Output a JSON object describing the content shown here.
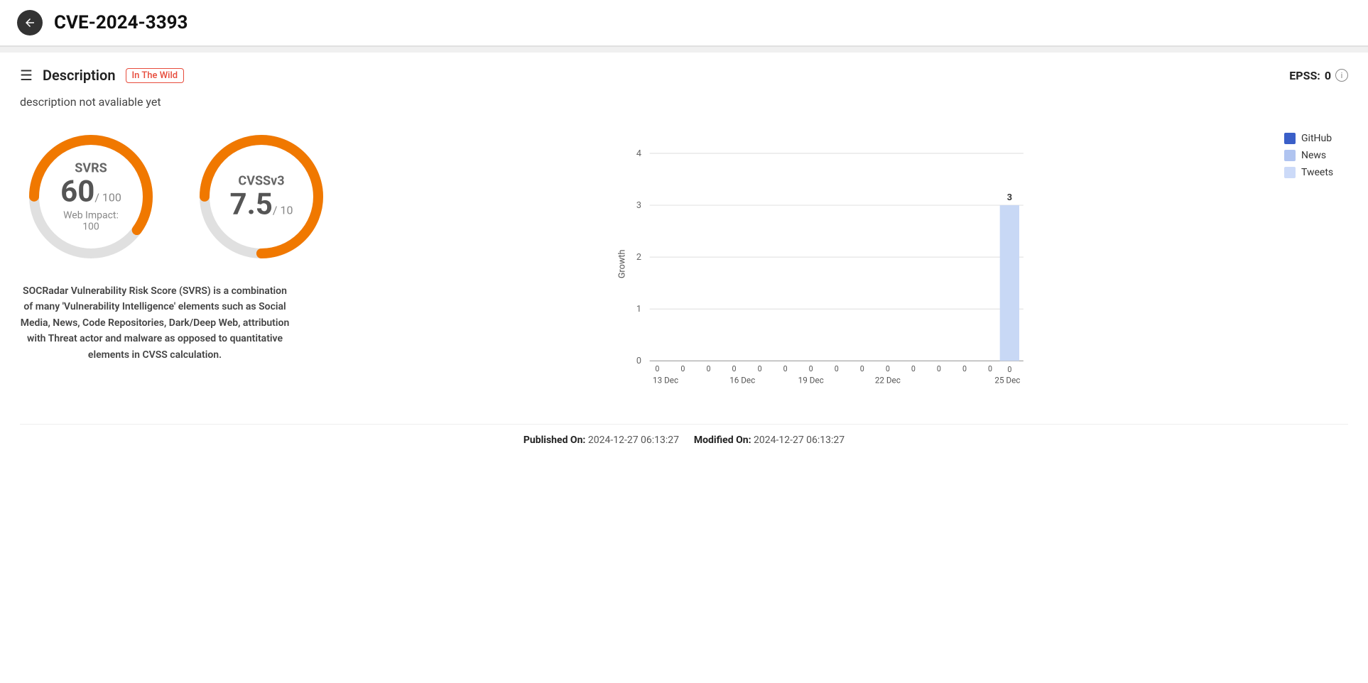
{
  "header": {
    "title": "CVE-2024-3393",
    "back_label": "back"
  },
  "description_section": {
    "title": "Description",
    "badge": "In The Wild",
    "desc_text": "description not avaliable yet",
    "epss_label": "EPSS:",
    "epss_value": "0"
  },
  "svrs": {
    "name": "SVRS",
    "value": "60",
    "denom": "/ 100",
    "sub": "Web Impact: 100",
    "gauge_percent": 60,
    "desc": "SOCRadar Vulnerability Risk Score (SVRS) is a combination of many 'Vulnerability Intelligence' elements such as Social Media, News, Code Repositories, Dark/Deep Web, attribution with Threat actor and malware as opposed to quantitative elements in CVSS calculation."
  },
  "cvss": {
    "name": "CVSSv3",
    "value": "7.5",
    "denom": "/ 10",
    "gauge_percent": 75
  },
  "chart": {
    "y_labels": [
      "0",
      "1",
      "2",
      "3",
      "4"
    ],
    "x_labels": [
      "13 Dec",
      "16 Dec",
      "19 Dec",
      "22 Dec",
      "25 Dec"
    ],
    "bar_labels": [
      "0",
      "0",
      "0",
      "0",
      "0",
      "0",
      "0",
      "0",
      "0",
      "0",
      "0",
      "0",
      "0",
      "0",
      "3"
    ],
    "peak_label": "3",
    "y_axis_label": "Growth",
    "legend": [
      {
        "label": "GitHub",
        "color": "#3a5fc8"
      },
      {
        "label": "News",
        "color": "#b0c4f0"
      },
      {
        "label": "Tweets",
        "color": "#ccdaf8"
      }
    ]
  },
  "footer": {
    "published_label": "Published On:",
    "published_value": "2024-12-27 06:13:27",
    "modified_label": "Modified On:",
    "modified_value": "2024-12-27 06:13:27"
  }
}
